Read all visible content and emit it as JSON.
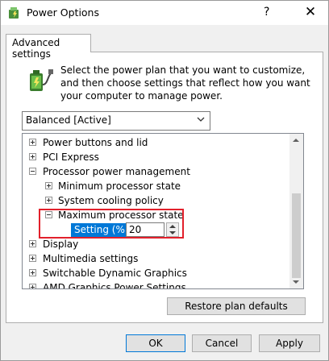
{
  "window": {
    "title": "Power Options",
    "help": "?",
    "close": "✕"
  },
  "tab": {
    "label": "Advanced settings"
  },
  "description": "Select the power plan that you want to customize, and then choose settings that reflect how you want your computer to manage power.",
  "plan": {
    "selected": "Balanced [Active]"
  },
  "tree": {
    "items": [
      {
        "label": "Power buttons and lid",
        "level": 0,
        "state": "collapsed"
      },
      {
        "label": "PCI Express",
        "level": 0,
        "state": "collapsed"
      },
      {
        "label": "Processor power management",
        "level": 0,
        "state": "expanded"
      },
      {
        "label": "Minimum processor state",
        "level": 1,
        "state": "collapsed"
      },
      {
        "label": "System cooling policy",
        "level": 1,
        "state": "collapsed"
      },
      {
        "label": "Maximum processor state",
        "level": 1,
        "state": "expanded"
      },
      {
        "label": "Display",
        "level": 0,
        "state": "collapsed"
      },
      {
        "label": "Multimedia settings",
        "level": 0,
        "state": "collapsed"
      },
      {
        "label": "Switchable Dynamic Graphics",
        "level": 0,
        "state": "collapsed"
      },
      {
        "label": "AMD Graphics Power Settings",
        "level": 0,
        "state": "collapsed"
      }
    ],
    "setting": {
      "label": "Setting (%):",
      "value": "20"
    }
  },
  "buttons": {
    "restore": "Restore plan defaults",
    "ok": "OK",
    "cancel": "Cancel",
    "apply": "Apply"
  }
}
